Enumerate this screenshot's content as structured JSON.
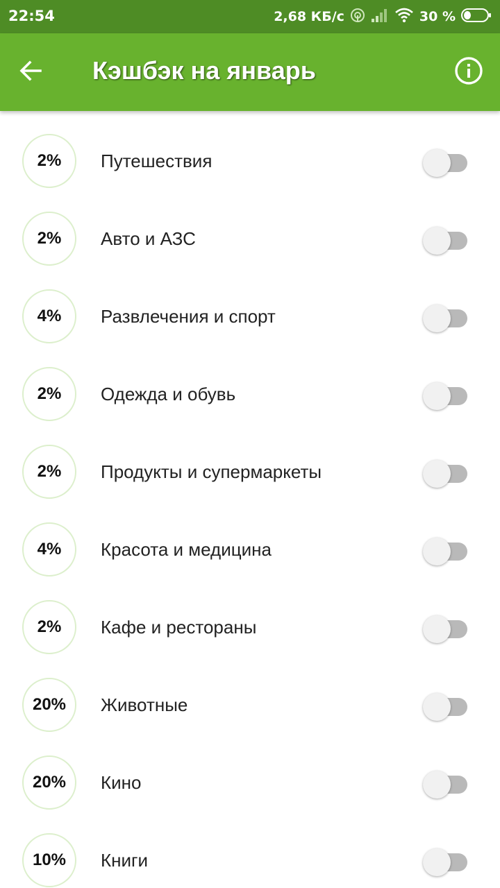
{
  "status_bar": {
    "time": "22:54",
    "network_speed": "2,68 КБ/с",
    "battery_percent": "30 %",
    "battery_level": 0.3
  },
  "header": {
    "title": "Кэшбэк на январь",
    "icons": {
      "back": "arrow-back-icon",
      "info": "info-icon"
    }
  },
  "colors": {
    "status_bar": "#4e8c25",
    "app_bar": "#68b22e",
    "badge_border": "#dcefcc",
    "toggle_track_off": "#b9b9b9",
    "toggle_thumb_off": "#f1f1f1"
  },
  "categories": [
    {
      "percent": "2%",
      "label": "Путешествия",
      "enabled": false
    },
    {
      "percent": "2%",
      "label": "Авто и АЗС",
      "enabled": false
    },
    {
      "percent": "4%",
      "label": "Развлечения и спорт",
      "enabled": false
    },
    {
      "percent": "2%",
      "label": "Одежда и обувь",
      "enabled": false
    },
    {
      "percent": "2%",
      "label": "Продукты и супермаркеты",
      "enabled": false
    },
    {
      "percent": "4%",
      "label": "Красота и медицина",
      "enabled": false
    },
    {
      "percent": "2%",
      "label": "Кафе и рестораны",
      "enabled": false
    },
    {
      "percent": "20%",
      "label": "Животные",
      "enabled": false
    },
    {
      "percent": "20%",
      "label": "Кино",
      "enabled": false
    },
    {
      "percent": "10%",
      "label": "Книги",
      "enabled": false
    }
  ]
}
